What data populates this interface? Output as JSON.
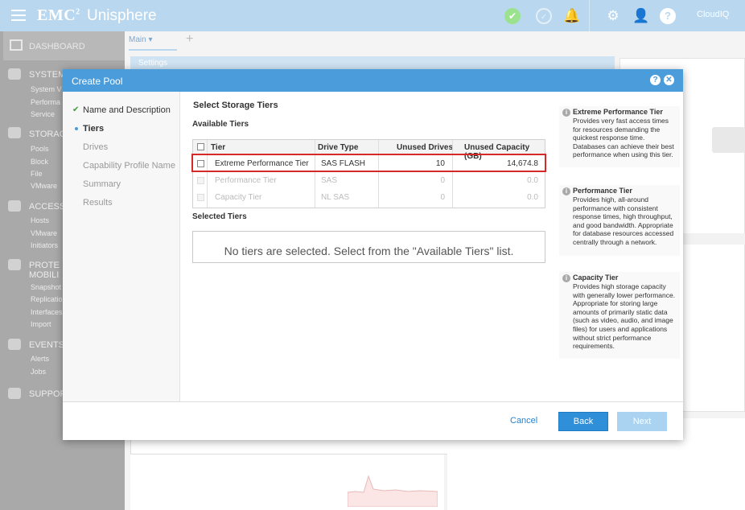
{
  "topbar": {
    "brand": "EMC",
    "brand_sup": "2",
    "app_name": "Unisphere",
    "cloudiq_label": "CloudIQ"
  },
  "sidebar": {
    "dashboard_label": "DASHBOARD",
    "sections": [
      {
        "label": "SYSTEM",
        "items": [
          "System V",
          "Performa",
          "Service"
        ]
      },
      {
        "label": "STORAGE",
        "items": [
          "Pools",
          "Block",
          "File",
          "VMware"
        ]
      },
      {
        "label": "ACCESS",
        "items": [
          "Hosts",
          "VMware",
          "Initiators"
        ]
      },
      {
        "label": "PROTECTION & MOBILITY",
        "items": [
          "Snapshot",
          "Replicatio",
          "Interfaces",
          "Import"
        ]
      },
      {
        "label": "EVENTS",
        "items": [
          "Alerts",
          "Jobs"
        ]
      },
      {
        "label": "SUPPORT",
        "items": []
      }
    ]
  },
  "main": {
    "tab_label": "Main",
    "panel_title": "Settings"
  },
  "modal": {
    "title": "Create Pool",
    "steps": [
      "Name and Description",
      "Tiers",
      "Drives",
      "Capability Profile Name",
      "Summary",
      "Results"
    ],
    "current_step": "Tiers",
    "section_title": "Select Storage Tiers",
    "available_title": "Available Tiers",
    "columns": [
      "Tier",
      "Drive Type",
      "Unused Drives",
      "Unused Capacity (GB)"
    ],
    "rows": [
      {
        "tier": "Extreme Performance Tier",
        "drive_type": "SAS FLASH",
        "unused_drives": "10",
        "unused_capacity": "14,674.8"
      },
      {
        "tier": "Performance Tier",
        "drive_type": "SAS",
        "unused_drives": "0",
        "unused_capacity": "0.0"
      },
      {
        "tier": "Capacity Tier",
        "drive_type": "NL SAS",
        "unused_drives": "0",
        "unused_capacity": "0.0"
      }
    ],
    "selected_title": "Selected Tiers",
    "selected_empty": "No tiers are selected. Select from the \"Available Tiers\" list.",
    "info": [
      {
        "title": "Extreme Performance Tier",
        "text": "Provides very fast access times for resources demanding the quickest response time. Databases can achieve their best performance when using this tier."
      },
      {
        "title": "Performance Tier",
        "text": "Provides high, all-around performance with consistent response times, high throughput, and good bandwidth. Appropriate for database resources accessed centrally through a network."
      },
      {
        "title": "Capacity Tier",
        "text": "Provides high storage capacity with generally lower performance. Appropriate for storing large amounts of primarily static data (such as video, audio, and image files) for users and applications without strict performance requirements."
      }
    ],
    "cancel_label": "Cancel",
    "back_label": "Back",
    "next_label": "Next"
  },
  "colors": {
    "topbar": "#b9d8ef",
    "modal_header": "#4a9cdb",
    "highlight": "#d52a2a",
    "primary_button": "#2f8fd8",
    "disabled_button": "#a9d3f1"
  }
}
